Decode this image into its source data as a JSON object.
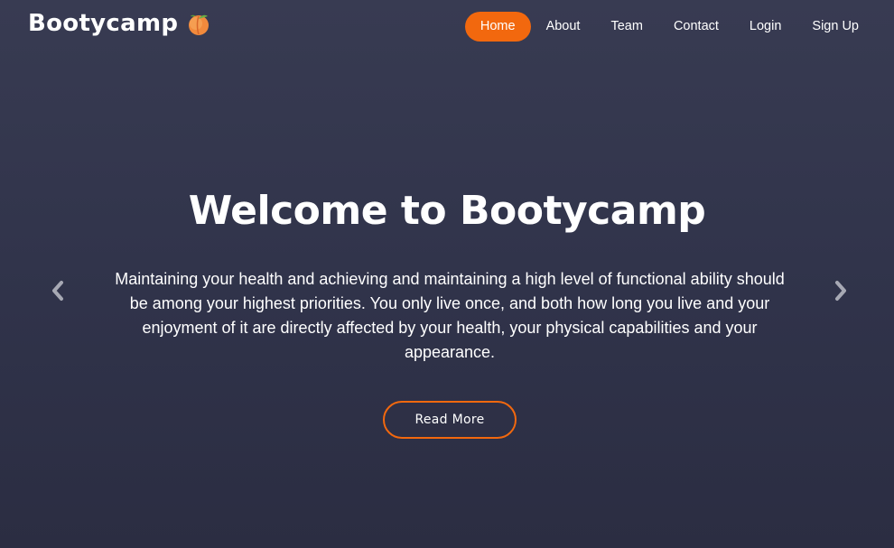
{
  "navbar": {
    "brand": "Bootycamp",
    "brand_icon": "peach-emoji",
    "links": [
      {
        "label": "Home",
        "active": true
      },
      {
        "label": "About",
        "active": false
      },
      {
        "label": "Team",
        "active": false
      },
      {
        "label": "Contact",
        "active": false
      },
      {
        "label": "Login",
        "active": false
      },
      {
        "label": "Sign Up",
        "active": false
      }
    ]
  },
  "hero": {
    "title": "Welcome to Bootycamp",
    "text": "Maintaining your health and achieving and maintaining a high level of functional ability should be among your highest priorities. You only live once, and both how long you live and your enjoyment of it are directly affected by your health, your physical capabilities and your appearance.",
    "button_label": "Read More"
  },
  "carousel": {
    "prev_icon": "chevron-left-icon",
    "next_icon": "chevron-right-icon"
  },
  "colors": {
    "accent": "#f2680e",
    "background_top": "#383b52",
    "background_bottom": "#2b2d42",
    "chevron": "#a7a9b4"
  }
}
